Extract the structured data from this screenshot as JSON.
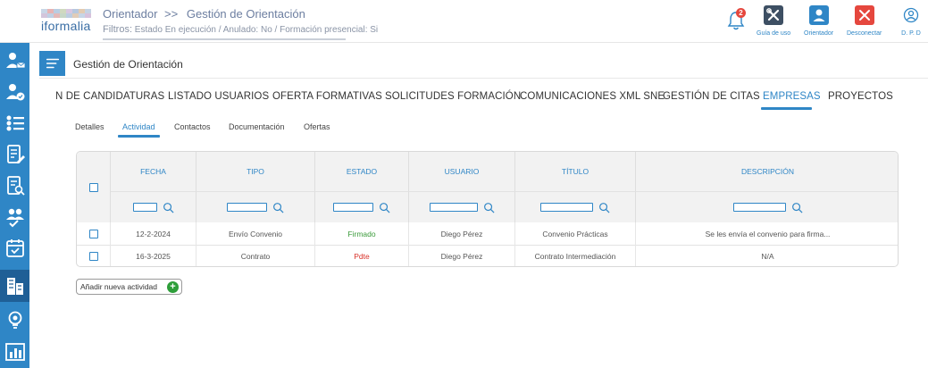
{
  "header": {
    "logo_text": "iformalia",
    "breadcrumb_root": "Orientador",
    "breadcrumb_sep": ">>",
    "breadcrumb_current": "Gestión de Orientación",
    "filters_label": "Filtros:",
    "filters_value": "Estado En ejecución / Anulado: No / Formación presencial: Si",
    "notifications_count": "2",
    "buttons": {
      "guide": "Guía de uso",
      "orientador": "Orientador",
      "disconnect": "Desconectar",
      "dpd": "D. P. D"
    }
  },
  "section": {
    "title": "Gestión de Orientación"
  },
  "tabs": [
    {
      "label": "N DE CANDIDATURAS"
    },
    {
      "label": "LISTADO USUARIOS"
    },
    {
      "label": "OFERTA FORMATIVAS"
    },
    {
      "label": "SOLICITUDES FORMACIÓN"
    },
    {
      "label": "COMUNICACIONES XML SNE"
    },
    {
      "label": "GESTIÓN DE CITAS"
    },
    {
      "label": "EMPRESAS",
      "active": true
    },
    {
      "label": "PROYECTOS"
    }
  ],
  "subtabs": [
    {
      "label": "Detalles"
    },
    {
      "label": "Actividad",
      "active": true
    },
    {
      "label": "Contactos"
    },
    {
      "label": "Documentación"
    },
    {
      "label": "Ofertas"
    }
  ],
  "table": {
    "columns": [
      "FECHA",
      "TIPO",
      "ESTADO",
      "USUARIO",
      "TÍTULO",
      "DESCRIPCIÓN"
    ],
    "rows": [
      {
        "fecha": "12-2-2024",
        "tipo": "Envío Convenio",
        "estado": "Firmado",
        "usuario": "Diego Pérez",
        "titulo": "Convenio Prácticas",
        "descripcion": "Se les envía el convenio para firma..."
      },
      {
        "fecha": "16-3-2025",
        "tipo": "Contrato",
        "estado": "Pdte",
        "usuario": "Diego Pérez",
        "titulo": "Contrato Intermediación",
        "descripcion": "N/A"
      }
    ]
  },
  "add_button": {
    "label": "Añadir nueva actividad"
  },
  "colors": {
    "primary": "#2f86c6",
    "sidebar_active": "#1f5f96",
    "status_ok": "#3a9a3a",
    "status_pending": "#d9322a",
    "disconnect": "#e5473e",
    "orientador_btn": "#2f86c6",
    "guide_btn": "#3d4f63"
  },
  "sidebar_icons": [
    "user-mail-icon",
    "user-check-icon",
    "user-list-icon",
    "document-edit-icon",
    "document-search-icon",
    "users-check-icon",
    "calendar-check-icon",
    "buildings-icon",
    "lightbulb-icon",
    "chart-icon"
  ]
}
